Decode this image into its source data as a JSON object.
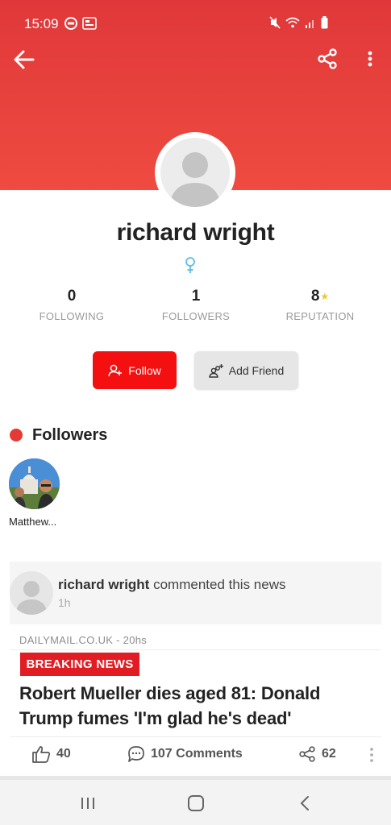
{
  "status_bar": {
    "time": "15:09"
  },
  "profile": {
    "name": "richard wright",
    "stats": [
      {
        "value": "0",
        "label": "FOLLOWING"
      },
      {
        "value": "1",
        "label": "FOLLOWERS"
      },
      {
        "value": "8",
        "label": "REPUTATION"
      }
    ]
  },
  "buttons": {
    "follow": "Follow",
    "add_friend": "Add Friend"
  },
  "followers_section": {
    "title": "Followers",
    "items": [
      {
        "name": "Matthew..."
      }
    ]
  },
  "activity": {
    "user": "richard wright",
    "action": " commented this news",
    "time": "1h"
  },
  "news": {
    "source": "DAILYMAIL.CO.UK - 20hs",
    "badge": "BREAKING NEWS",
    "headline": "Robert Mueller dies aged 81: Donald Trump fumes 'I'm glad he's dead'",
    "likes": "40",
    "comments": "107 Comments",
    "shares": "62"
  },
  "colors": {
    "header_red": "#e0383a",
    "follow_red": "#f41010",
    "badge_red": "#e11d23",
    "star": "#f3c623",
    "gender": "#5bc0de"
  },
  "icons": {
    "back": "arrow-left-icon",
    "share": "share-icon",
    "more": "more-vertical-icon",
    "gender": "female-icon",
    "follow": "add-user-icon",
    "add_friend": "add-friend-icon",
    "like": "thumbs-up-icon",
    "comment": "comment-icon",
    "share_count": "share-icon"
  }
}
